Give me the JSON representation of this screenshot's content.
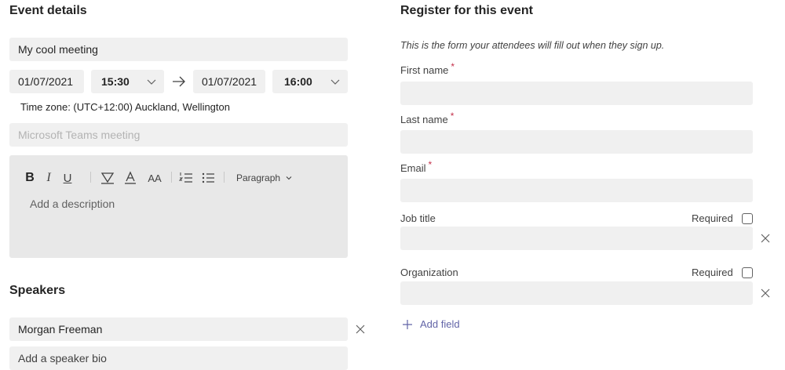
{
  "event_details": {
    "heading": "Event details",
    "title_value": "My cool meeting",
    "start_date": "01/07/2021",
    "start_time": "15:30",
    "end_date": "01/07/2021",
    "end_time": "16:00",
    "timezone": "Time zone: (UTC+12:00) Auckland, Wellington",
    "location_placeholder": "Microsoft Teams meeting",
    "toolbar": {
      "bold": "B",
      "italic": "I",
      "underline": "U",
      "font_size": "AA",
      "paragraph_label": "Paragraph"
    },
    "description_placeholder": "Add a description"
  },
  "speakers": {
    "heading": "Speakers",
    "name_value": "Morgan Freeman",
    "bio_placeholder": "Add a speaker bio"
  },
  "register": {
    "heading": "Register for this event",
    "subtitle": "This is the form your attendees will fill out when they sign up.",
    "required_mark": "*",
    "fields": [
      {
        "label": "First name",
        "required": true
      },
      {
        "label": "Last name",
        "required": true
      },
      {
        "label": "Email",
        "required": true
      },
      {
        "label": "Job title",
        "required_label": "Required"
      },
      {
        "label": "Organization",
        "required_label": "Required"
      }
    ],
    "add_field_label": "Add field"
  },
  "colors": {
    "field_bg": "#f0f0f0",
    "editor_bg": "#e8e8e8",
    "accent": "#6264a7",
    "required": "#c4314b"
  }
}
